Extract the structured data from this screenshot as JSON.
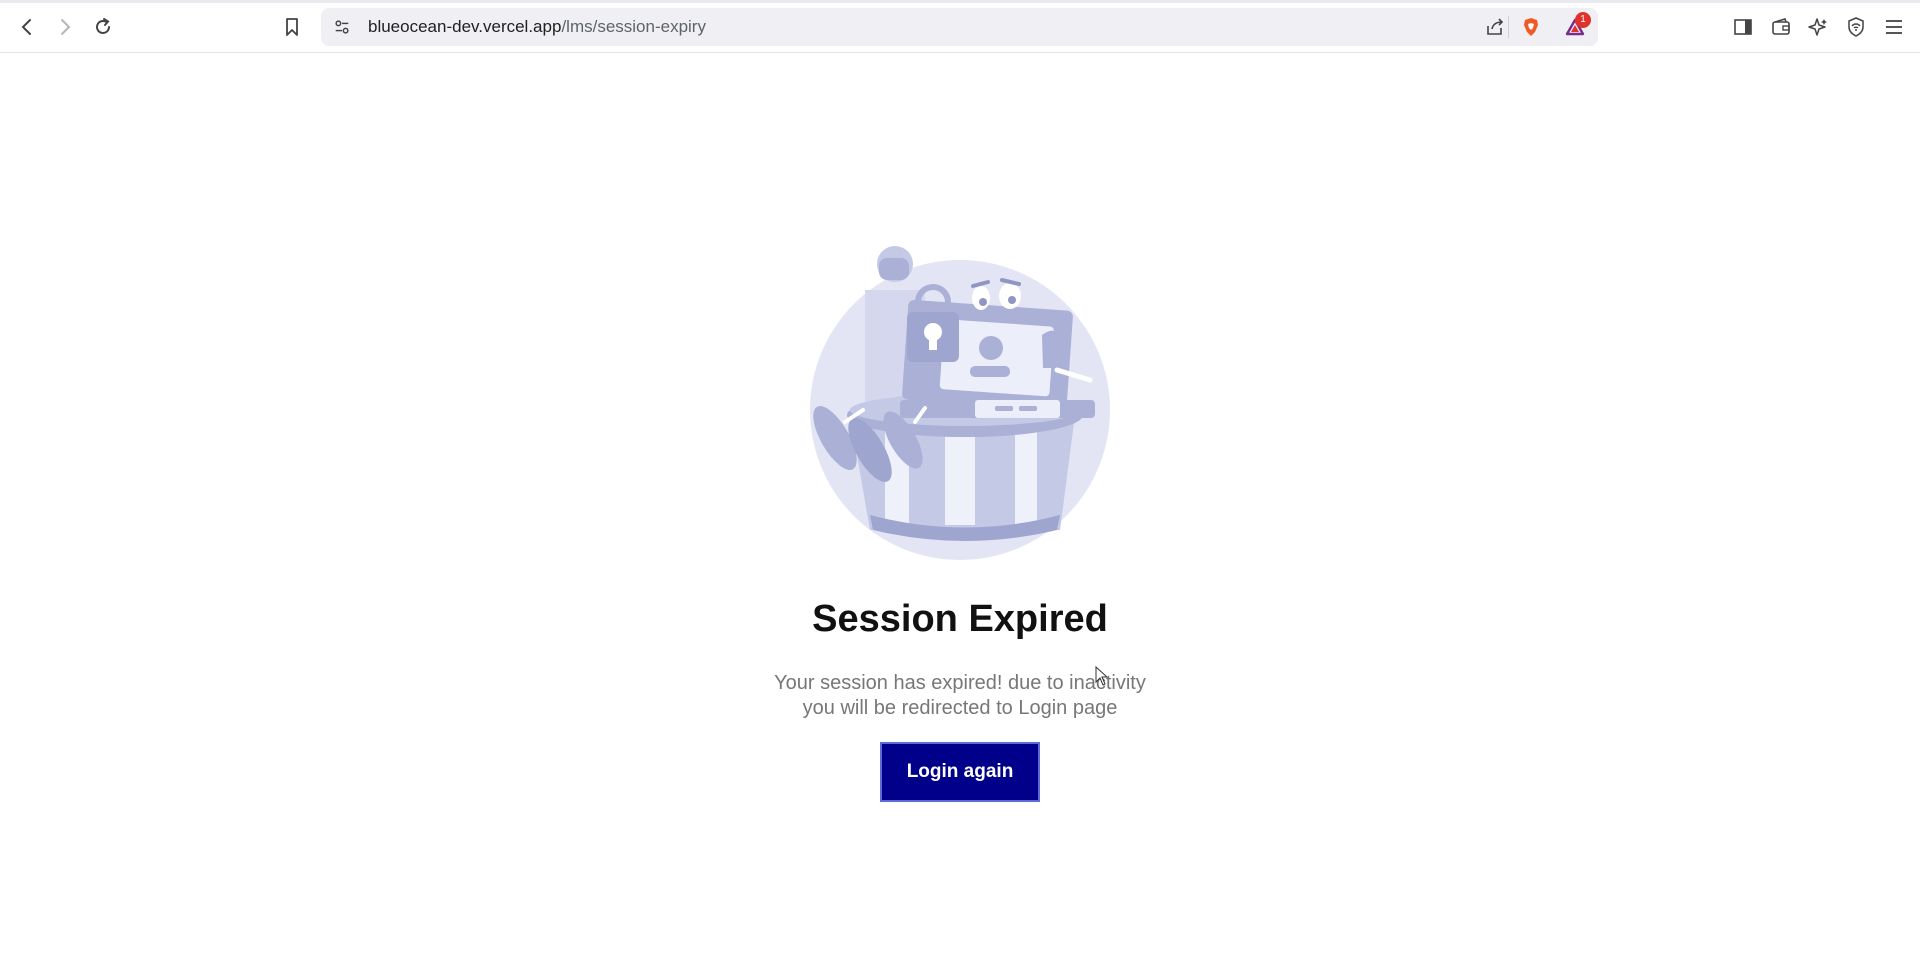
{
  "browser": {
    "url_host": "blueocean-dev.vercel.app",
    "url_path": "/lms/session-expiry",
    "notification_count": "1",
    "icons": [
      "back-icon",
      "forward-icon",
      "reload-icon",
      "bookmark-icon",
      "site-settings-icon",
      "share-icon",
      "brave-shields-icon",
      "brave-rewards-icon",
      "sidebar-icon",
      "wallet-icon",
      "leo-ai-icon",
      "vpn-icon",
      "menu-icon"
    ]
  },
  "page": {
    "title": "Session Expired",
    "message_line1": "Your session has expired! due to inactivity",
    "message_line2": "you will be redirected to Login page",
    "login_button": "Login again"
  },
  "colors": {
    "button_bg": "#00008b",
    "illustration_bg": "#e3e5f5",
    "illustration_main": "#aab0d6"
  }
}
